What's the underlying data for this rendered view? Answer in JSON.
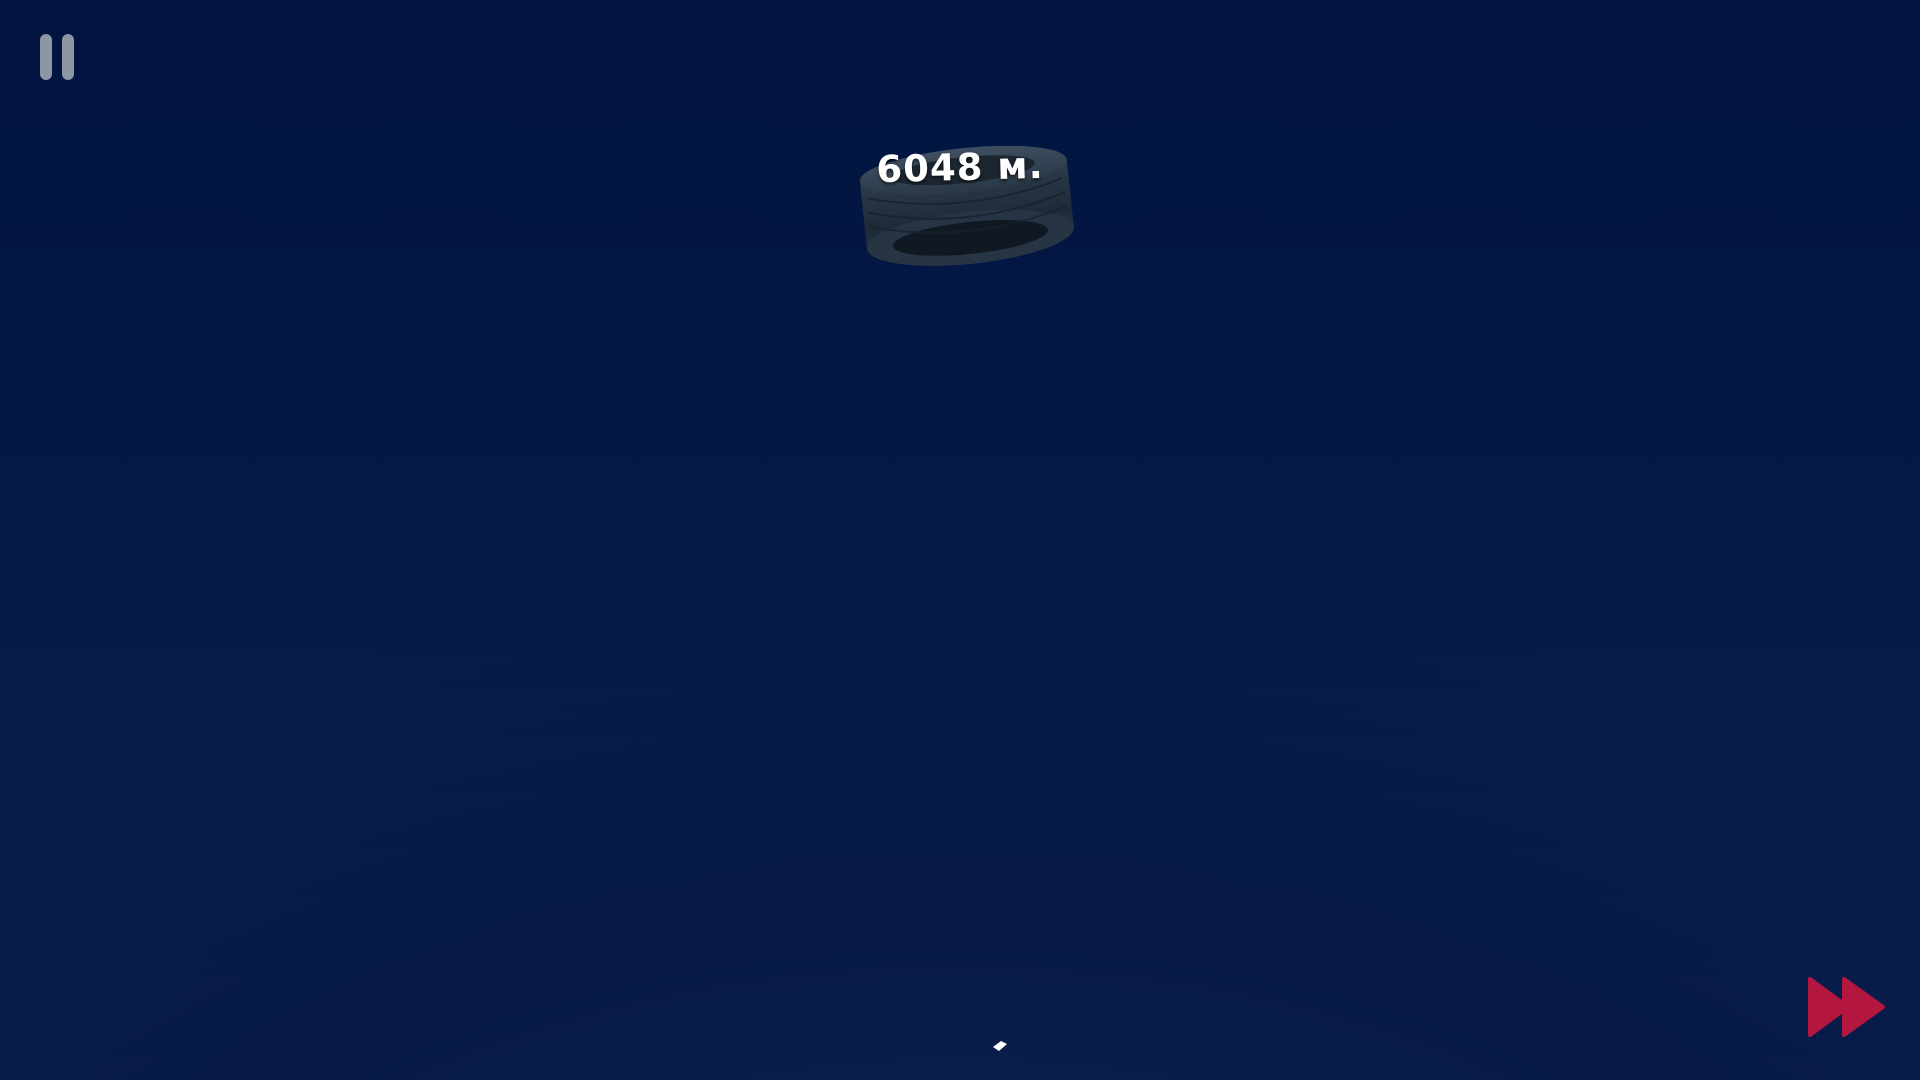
{
  "hud": {
    "distance_label": "6048 м.",
    "pause_icon": "pause-icon",
    "fast_forward_icon": "fast-forward-icon"
  },
  "scene": {
    "falling_object": "tire",
    "player_marker": "player-marker"
  },
  "colors": {
    "sky_top": "#021440",
    "sky_bottom": "#0a2350",
    "pause_button": "#8e95a3",
    "fast_forward": "#b3163f",
    "distance_text": "#ffffff"
  }
}
